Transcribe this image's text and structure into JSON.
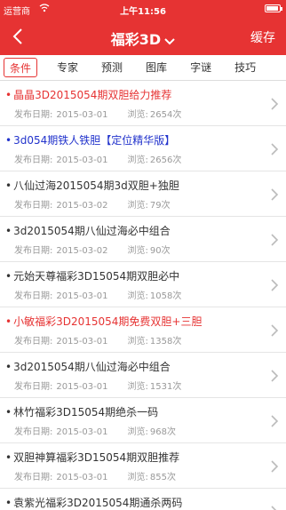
{
  "status_bar": {
    "carrier": "运营商",
    "time": "上午11:56"
  },
  "nav": {
    "title": "福彩3D",
    "right_label": "缓存"
  },
  "tabs": [
    {
      "label": "条件",
      "active": true
    },
    {
      "label": "专家",
      "active": false
    },
    {
      "label": "预测",
      "active": false
    },
    {
      "label": "图库",
      "active": false
    },
    {
      "label": "字谜",
      "active": false
    },
    {
      "label": "技巧",
      "active": false
    }
  ],
  "list_labels": {
    "date_label": "发布日期:",
    "views_label": "浏览:"
  },
  "articles": [
    {
      "title": "晶晶3D2015054期双胆给力推荐",
      "date": "2015-03-01",
      "views": "2654次",
      "color": "#e63333"
    },
    {
      "title": "3d054期铁人铁胆【定位精华版】",
      "date": "2015-03-01",
      "views": "2656次",
      "color": "#2233cc"
    },
    {
      "title": "八仙过海2015054期3d双胆+独胆",
      "date": "2015-03-02",
      "views": "79次",
      "color": "#333333"
    },
    {
      "title": "3d2015054期八仙过海必中组合",
      "date": "2015-03-02",
      "views": "90次",
      "color": "#333333"
    },
    {
      "title": "元始天尊福彩3D15054期双胆必中",
      "date": "2015-03-01",
      "views": "1058次",
      "color": "#333333"
    },
    {
      "title": "小敏福彩3D2015054期免费双胆+三胆",
      "date": "2015-03-01",
      "views": "1358次",
      "color": "#e63333"
    },
    {
      "title": "3d2015054期八仙过海必中组合",
      "date": "2015-03-01",
      "views": "1531次",
      "color": "#333333"
    },
    {
      "title": "林竹福彩3D15054期绝杀一码",
      "date": "2015-03-01",
      "views": "968次",
      "color": "#333333"
    },
    {
      "title": "双胆神算福彩3D15054期双胆推荐",
      "date": "2015-03-01",
      "views": "855次",
      "color": "#333333"
    },
    {
      "title": "袁紫光福彩3D2015054期通杀两码",
      "date": "",
      "views": "",
      "color": "#333333"
    }
  ],
  "colors": {
    "accent": "#e63333",
    "blue_title": "#2233cc"
  }
}
